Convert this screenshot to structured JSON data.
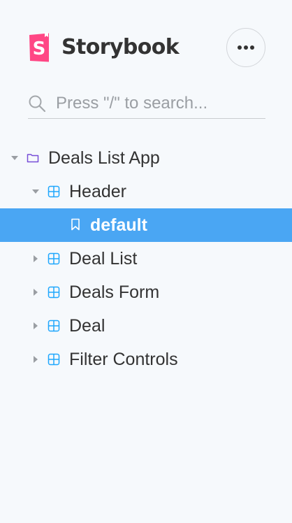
{
  "brand": {
    "name": "Storybook",
    "logo_letter": "S",
    "logo_color": "#ff4785"
  },
  "menu": {
    "icon": "ellipsis-icon"
  },
  "search": {
    "placeholder": "Press \"/\" to search...",
    "value": ""
  },
  "tree": [
    {
      "label": "Deals List App",
      "type": "folder",
      "expanded": true,
      "depth": 0
    },
    {
      "label": "Header",
      "type": "component",
      "expanded": true,
      "depth": 1
    },
    {
      "label": "default",
      "type": "story",
      "selected": true,
      "depth": 2
    },
    {
      "label": "Deal List",
      "type": "component",
      "expanded": false,
      "depth": 1
    },
    {
      "label": "Deals Form",
      "type": "component",
      "expanded": false,
      "depth": 1
    },
    {
      "label": "Deal",
      "type": "component",
      "expanded": false,
      "depth": 1
    },
    {
      "label": "Filter Controls",
      "type": "component",
      "expanded": false,
      "depth": 1
    }
  ],
  "colors": {
    "background": "#f6f9fc",
    "selected": "#4aa6f3",
    "folder_icon": "#774dd7",
    "component_icon": "#1ea7fd",
    "text": "#333333"
  }
}
